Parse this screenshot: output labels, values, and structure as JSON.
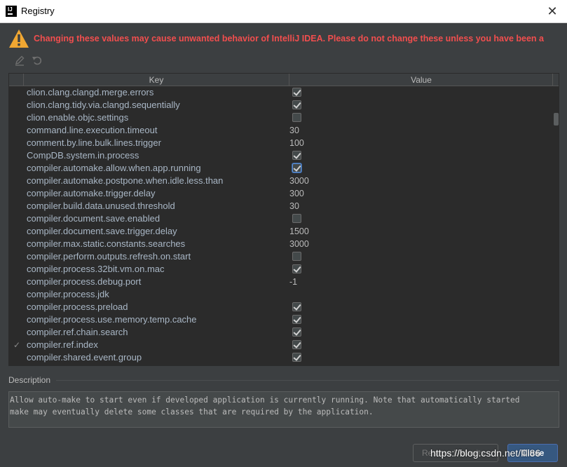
{
  "window": {
    "title": "Registry",
    "close_glyph": "✕"
  },
  "warning": {
    "icon": "warning-triangle-icon",
    "text": "Changing these values may cause unwanted behavior of IntelliJ IDEA. Please do not change these unless you have been a"
  },
  "toolbar": {
    "edit_icon": "pencil-icon",
    "revert_icon": "undo-icon"
  },
  "table": {
    "columns": {
      "key": "Key",
      "value": "Value"
    },
    "rows": [
      {
        "key": "clion.clang.clangd.merge.errors",
        "type": "bool",
        "checked": true
      },
      {
        "key": "clion.clang.tidy.via.clangd.sequentially",
        "type": "bool",
        "checked": true
      },
      {
        "key": "clion.enable.objc.settings",
        "type": "bool",
        "checked": false
      },
      {
        "key": "command.line.execution.timeout",
        "type": "text",
        "value": "30"
      },
      {
        "key": "comment.by.line.bulk.lines.trigger",
        "type": "text",
        "value": "100"
      },
      {
        "key": "CompDB.system.in.process",
        "type": "bool",
        "checked": true
      },
      {
        "key": "compiler.automake.allow.when.app.running",
        "type": "bool",
        "checked": true,
        "focused": true
      },
      {
        "key": "compiler.automake.postpone.when.idle.less.than",
        "type": "text",
        "value": "3000"
      },
      {
        "key": "compiler.automake.trigger.delay",
        "type": "text",
        "value": "300"
      },
      {
        "key": "compiler.build.data.unused.threshold",
        "type": "text",
        "value": "30"
      },
      {
        "key": "compiler.document.save.enabled",
        "type": "bool",
        "checked": false
      },
      {
        "key": "compiler.document.save.trigger.delay",
        "type": "text",
        "value": "1500"
      },
      {
        "key": "compiler.max.static.constants.searches",
        "type": "text",
        "value": "3000"
      },
      {
        "key": "compiler.perform.outputs.refresh.on.start",
        "type": "bool",
        "checked": false
      },
      {
        "key": "compiler.process.32bit.vm.on.mac",
        "type": "bool",
        "checked": true
      },
      {
        "key": "compiler.process.debug.port",
        "type": "text",
        "value": "-1"
      },
      {
        "key": "compiler.process.jdk",
        "type": "text",
        "value": ""
      },
      {
        "key": "compiler.process.preload",
        "type": "bool",
        "checked": true
      },
      {
        "key": "compiler.process.use.memory.temp.cache",
        "type": "bool",
        "checked": true
      },
      {
        "key": "compiler.ref.chain.search",
        "type": "bool",
        "checked": true
      },
      {
        "key": "compiler.ref.index",
        "type": "bool",
        "checked": true,
        "modified": true,
        "mark": "✓"
      },
      {
        "key": "compiler.shared.event.group",
        "type": "bool",
        "checked": true
      }
    ]
  },
  "description": {
    "label": "Description",
    "text": "Allow auto-make to start even if developed application is currently running. Note that automatically started\nmake may eventually delete some classes that are required by the application."
  },
  "buttons": {
    "restore": "Restore Defaults",
    "close": "Close"
  },
  "watermark": "https://blog.csdn.net/lili86",
  "colors": {
    "warning": "#f24e4e",
    "background": "#3c3f41",
    "table_bg": "#2b2b2b",
    "accent": "#365880"
  }
}
